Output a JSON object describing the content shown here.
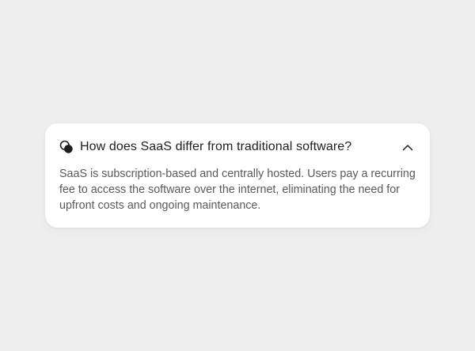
{
  "faq": {
    "question": "How does SaaS differ from traditional software?",
    "answer": "SaaS is subscription-based and centrally hosted. Users pay a recurring fee to access the software over the internet, eliminating the need for upfront costs and ongoing maintenance.",
    "expanded": true,
    "icon": "chat-bubbles-icon",
    "toggle_icon": "chevron-up-icon"
  },
  "colors": {
    "background": "#eeeeee",
    "card": "#ffffff",
    "question_text": "#1e1e1e",
    "answer_text": "#5a5a5a"
  }
}
